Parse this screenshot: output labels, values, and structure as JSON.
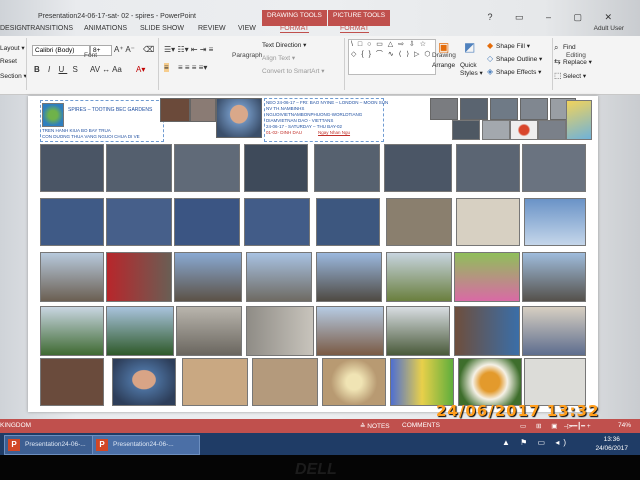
{
  "window": {
    "title": "Presentation24-06-17-sat- 02 - spires - PowerPoint",
    "context_tabs": [
      "DRAWING TOOLS",
      "PICTURE TOOLS"
    ],
    "controls": "?  ▭  –  ▢  ✕",
    "user": "Adult User"
  },
  "tabs": [
    {
      "label": "DESIGN"
    },
    {
      "label": "TRANSITIONS"
    },
    {
      "label": "ANIMATIONS"
    },
    {
      "label": "SLIDE SHOW"
    },
    {
      "label": "REVIEW"
    },
    {
      "label": "VIEW"
    },
    {
      "label": "FORMAT"
    },
    {
      "label": "FORMAT"
    }
  ],
  "ribbon": {
    "slide_group": [
      "Layout ▾",
      "Reset",
      "Section ▾"
    ],
    "font_name": "Calibri (Body)",
    "font_size": "8+",
    "groups": {
      "font": "Font",
      "paragraph": "Paragraph",
      "drawing": "Drawing",
      "editing": "Editing"
    },
    "paragraph_items": [
      "Text Direction ▾",
      "Align Text ▾",
      "Convert to SmartArt ▾"
    ],
    "drawing_items": [
      "Arrange",
      "Quick Styles ▾",
      "Shape Fill ▾",
      "Shape Outline ▾",
      "Shape Effects ▾"
    ],
    "editing_items": [
      "Find",
      "Replace ▾",
      "Select ▾"
    ],
    "shapes_glyphs": "\\ □ ○ ▭ △ ⇨ ⇩ ☆ ◇ { } ⌒ ∿ ⟨ ⟩ ▷ ⬡"
  },
  "slide": {
    "header_left": {
      "title": "SPIRES – TOOTING BEC GARDENS",
      "line1": "TREN HANH KIUA BO BAY TRUA",
      "line2": "CON DUONG THUA VANG NGUOI CHUA DI VE"
    },
    "header_right": {
      "line1": "NEO 24-06-17 – FRI: BAO NYINE – LONDON – MOON SUN",
      "line2": "NV TH.NAMBINHS",
      "line3": "NGUOIVIETNAMBONPHUONG-WORLDTIANG",
      "line4": "DIAMVIETNAN DAO - VIETTANS",
      "line5": "24-06-17 - SATURDAY – THU BAY-02",
      "line6": "01-02-  DINH DAU",
      "link": "Ngay Nhan Ngu"
    }
  },
  "statusbar": {
    "left": "KINGDOM",
    "notes": "≙ NOTES",
    "comments": "COMMENTS",
    "zoom": "74%"
  },
  "taskbar": {
    "buttons": [
      {
        "label": "Presentation24-06-..."
      },
      {
        "label": "Presentation24-06-..."
      }
    ],
    "tray": "▲ ⚑ ▭ ◂)",
    "time": "13:36",
    "date": "24/06/2017"
  },
  "photo_stamp": "24/06/2017  13:32",
  "monitor_brand": "DELL",
  "colors": {
    "accent": "#c0504d",
    "taskbar": "#1f3c66",
    "stamp": "#ff9d1c"
  }
}
